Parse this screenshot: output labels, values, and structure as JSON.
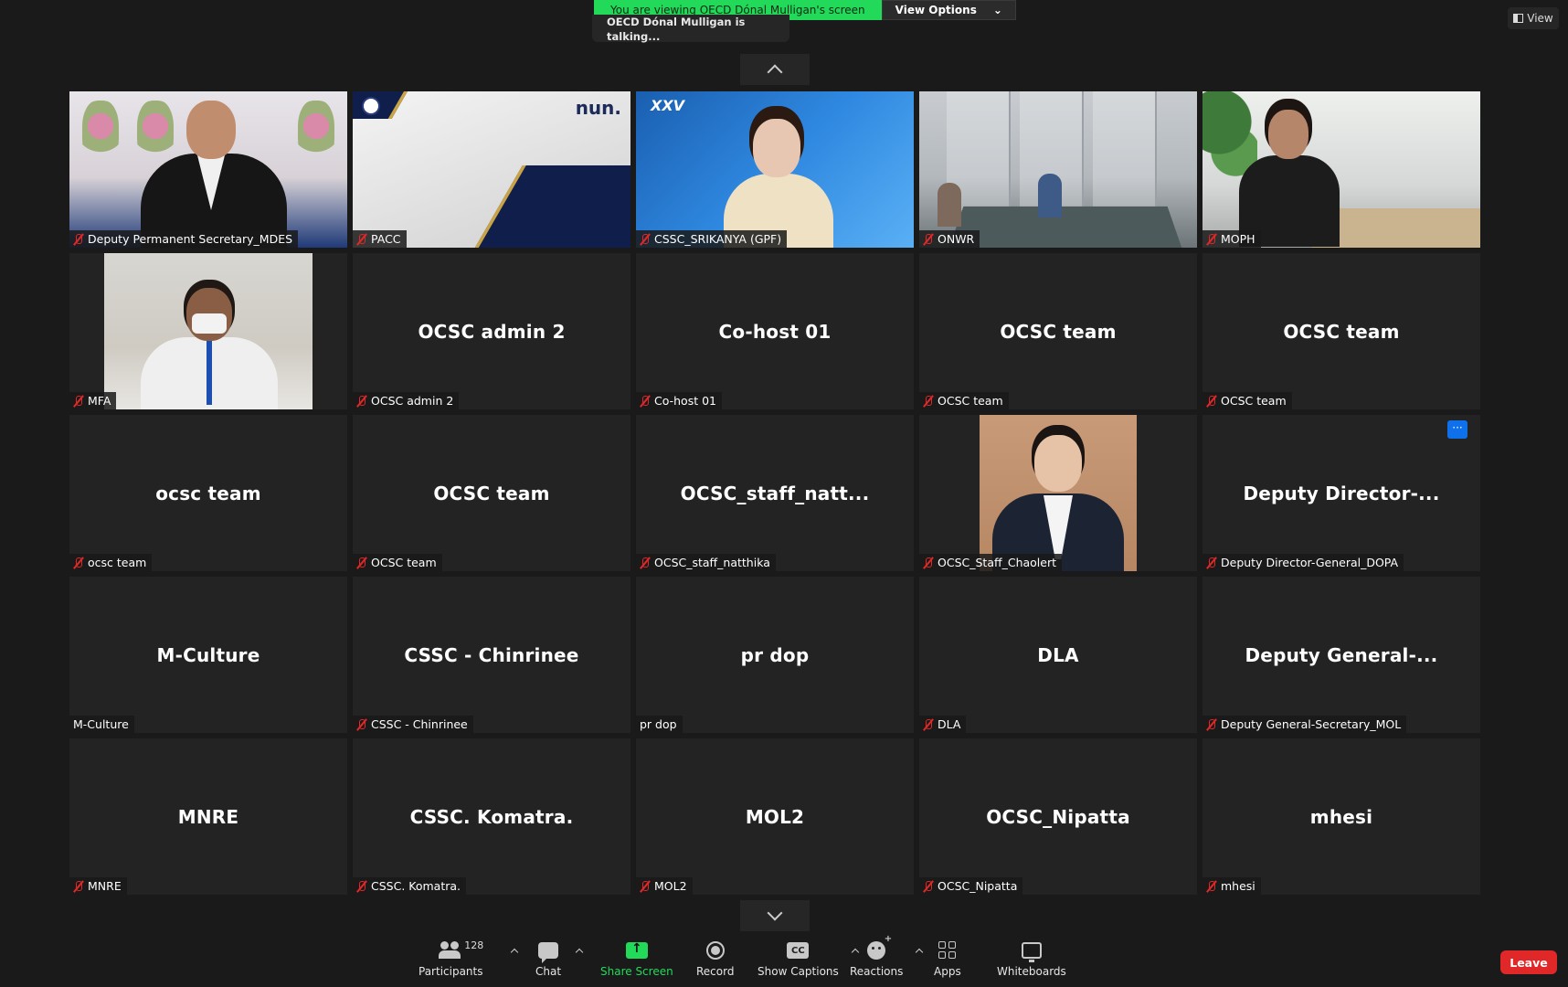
{
  "share_banner": {
    "viewing_text": "You are viewing OECD Dónal Mulligan's screen",
    "view_options_label": "View Options"
  },
  "talking_indicator": "OECD Dónal Mulligan is talking...",
  "view_button_label": "View",
  "participants": [
    {
      "name": "Deputy Permanent Secretary_MDES",
      "display": "",
      "muted": true,
      "video": "v1"
    },
    {
      "name": "PACC",
      "display": "",
      "muted": true,
      "video": "v2"
    },
    {
      "name": "CSSC_SRIKANYA (GPF)",
      "display": "",
      "muted": true,
      "video": "v3"
    },
    {
      "name": "ONWR",
      "display": "",
      "muted": true,
      "video": "v4"
    },
    {
      "name": "MOPH",
      "display": "",
      "muted": true,
      "video": "v5"
    },
    {
      "name": "MFA",
      "display": "",
      "muted": true,
      "video": "v6"
    },
    {
      "name": "OCSC admin 2",
      "display": "OCSC admin 2",
      "muted": true
    },
    {
      "name": "Co-host 01",
      "display": "Co-host 01",
      "muted": true
    },
    {
      "name": "OCSC team",
      "display": "OCSC team",
      "muted": true
    },
    {
      "name": "OCSC team",
      "display": "OCSC team",
      "muted": true
    },
    {
      "name": "ocsc team",
      "display": "ocsc team",
      "muted": true
    },
    {
      "name": "OCSC team",
      "display": "OCSC team",
      "muted": true
    },
    {
      "name": "OCSC_staff_natthika",
      "display": "OCSC_staff_natt...",
      "muted": true
    },
    {
      "name": "OCSC_Staff_Chaolert",
      "display": "",
      "muted": true,
      "video": "v14"
    },
    {
      "name": "Deputy Director-General_DOPA",
      "display": "Deputy  Director-...",
      "muted": true
    },
    {
      "name": "M-Culture",
      "display": "M-Culture",
      "muted": false
    },
    {
      "name": "CSSC - Chinrinee",
      "display": "CSSC - Chinrinee",
      "muted": true
    },
    {
      "name": "pr dop",
      "display": "pr dop",
      "muted": false
    },
    {
      "name": "DLA",
      "display": "DLA",
      "muted": true
    },
    {
      "name": "Deputy General-Secretary_MOL",
      "display": "Deputy  General-...",
      "muted": true
    },
    {
      "name": "MNRE",
      "display": "MNRE",
      "muted": true
    },
    {
      "name": "CSSC. Komatra.",
      "display": "CSSC. Komatra.",
      "muted": true
    },
    {
      "name": "MOL2",
      "display": "MOL2",
      "muted": true
    },
    {
      "name": "OCSC_Nipatta",
      "display": "OCSC_Nipatta",
      "muted": true
    },
    {
      "name": "mhesi",
      "display": "mhesi",
      "muted": true
    }
  ],
  "more_button_label": "···",
  "toolbar": {
    "participants_label": "Participants",
    "participants_count": "128",
    "chat_label": "Chat",
    "share_label": "Share Screen",
    "record_label": "Record",
    "captions_label": "Show Captions",
    "captions_icon_text": "CC",
    "reactions_label": "Reactions",
    "apps_label": "Apps",
    "whiteboards_label": "Whiteboards",
    "leave_label": "Leave"
  },
  "colors": {
    "share_banner": "#23d959",
    "mute": "#e02828",
    "leave": "#e02828",
    "more_button": "#0e71eb"
  }
}
